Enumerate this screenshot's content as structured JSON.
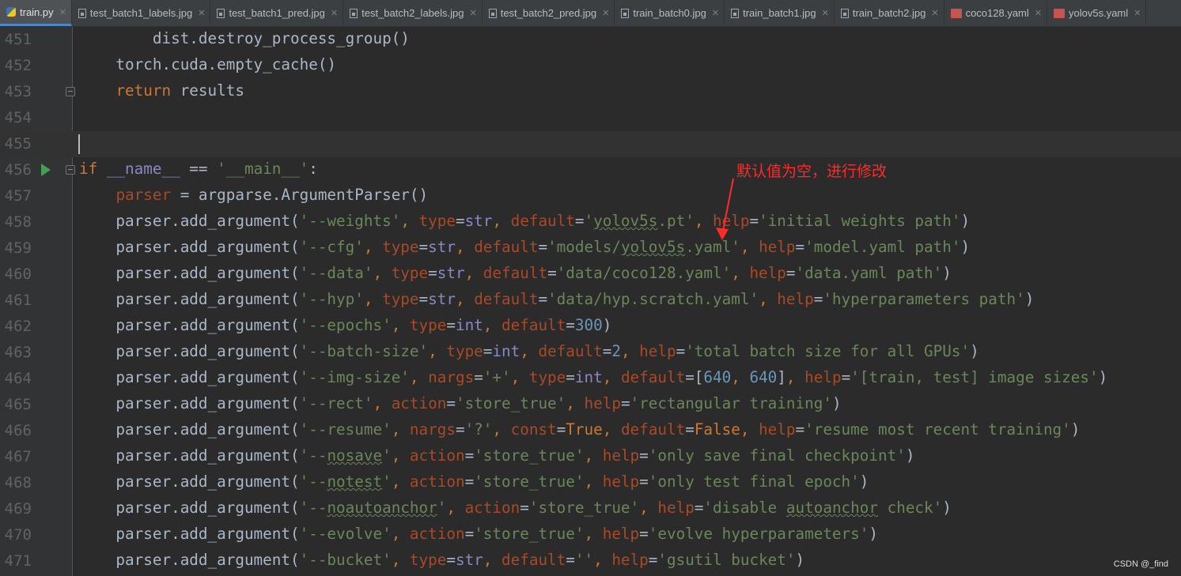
{
  "tabs": [
    {
      "label": "train.py",
      "icon": "python-file-icon",
      "active": true
    },
    {
      "label": "test_batch1_labels.jpg",
      "icon": "image-file-icon"
    },
    {
      "label": "test_batch1_pred.jpg",
      "icon": "image-file-icon"
    },
    {
      "label": "test_batch2_labels.jpg",
      "icon": "image-file-icon"
    },
    {
      "label": "test_batch2_pred.jpg",
      "icon": "image-file-icon"
    },
    {
      "label": "train_batch0.jpg",
      "icon": "image-file-icon"
    },
    {
      "label": "train_batch1.jpg",
      "icon": "image-file-icon"
    },
    {
      "label": "train_batch2.jpg",
      "icon": "image-file-icon"
    },
    {
      "label": "coco128.yaml",
      "icon": "yaml-file-icon"
    },
    {
      "label": "yolov5s.yaml",
      "icon": "yaml-file-icon"
    }
  ],
  "close_glyph": "✕",
  "lines": [
    {
      "num": "451",
      "code": "        dist.destroy_process_group()"
    },
    {
      "num": "452",
      "code": "    torch.cuda.empty_cache()"
    },
    {
      "num": "453",
      "code": "    return results"
    },
    {
      "num": "454",
      "code": ""
    },
    {
      "num": "455",
      "code": ""
    },
    {
      "num": "456",
      "code": "if __name__ == '__main__':"
    },
    {
      "num": "457",
      "code": "    parser = argparse.ArgumentParser()"
    },
    {
      "num": "458",
      "code": "    parser.add_argument('--weights', type=str, default='yolov5s.pt', help='initial weights path')"
    },
    {
      "num": "459",
      "code": "    parser.add_argument('--cfg', type=str, default='models/yolov5s.yaml', help='model.yaml path')"
    },
    {
      "num": "460",
      "code": "    parser.add_argument('--data', type=str, default='data/coco128.yaml', help='data.yaml path')"
    },
    {
      "num": "461",
      "code": "    parser.add_argument('--hyp', type=str, default='data/hyp.scratch.yaml', help='hyperparameters path')"
    },
    {
      "num": "462",
      "code": "    parser.add_argument('--epochs', type=int, default=300)"
    },
    {
      "num": "463",
      "code": "    parser.add_argument('--batch-size', type=int, default=2, help='total batch size for all GPUs')"
    },
    {
      "num": "464",
      "code": "    parser.add_argument('--img-size', nargs='+', type=int, default=[640, 640], help='[train, test] image sizes')"
    },
    {
      "num": "465",
      "code": "    parser.add_argument('--rect', action='store_true', help='rectangular training')"
    },
    {
      "num": "466",
      "code": "    parser.add_argument('--resume', nargs='?', const=True, default=False, help='resume most recent training')"
    },
    {
      "num": "467",
      "code": "    parser.add_argument('--nosave', action='store_true', help='only save final checkpoint')"
    },
    {
      "num": "468",
      "code": "    parser.add_argument('--notest', action='store_true', help='only test final epoch')"
    },
    {
      "num": "469",
      "code": "    parser.add_argument('--noautoanchor', action='store_true', help='disable autoanchor check')"
    },
    {
      "num": "470",
      "code": "    parser.add_argument('--evolve', action='store_true', help='evolve hyperparameters')"
    },
    {
      "num": "471",
      "code": "    parser.add_argument('--bucket', type=str, default='', help='gsutil bucket')"
    }
  ],
  "current_line": "455",
  "run_line": "456",
  "fold_lines": [
    "453",
    "456"
  ],
  "annotation": "默认值为空，进行修改",
  "watermark": "CSDN @_find",
  "colors": {
    "background": "#2b2b2b",
    "gutter": "#313335",
    "keyword": "#cc7832",
    "string": "#6a8759",
    "number": "#6897bb",
    "parameter": "#aa4926",
    "default_text": "#a9b7c6",
    "line_number": "#606366",
    "annotation": "#ff2a2a",
    "run_icon": "#499c54"
  }
}
